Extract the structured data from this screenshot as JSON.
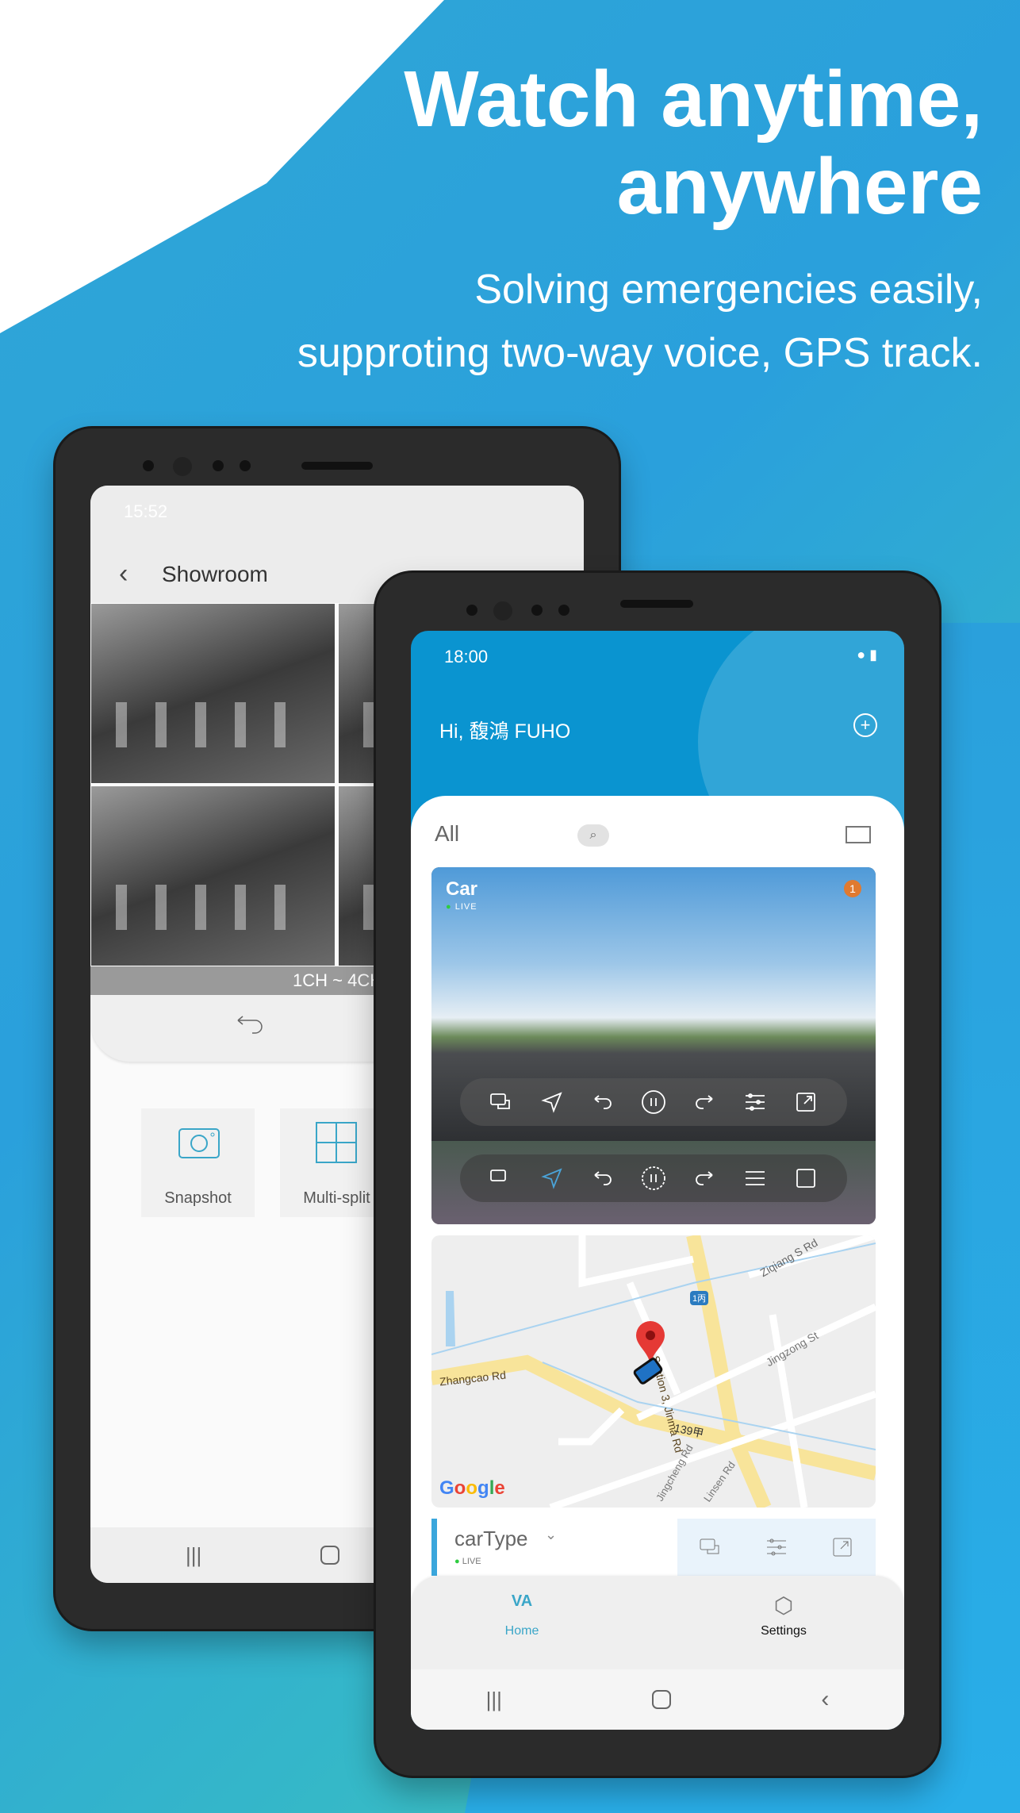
{
  "hero": {
    "title_line1": "Watch anytime,",
    "title_line2": "anywhere",
    "subtitle_line1": "Solving emergencies easily,",
    "subtitle_line2": "supproting two-way voice, GPS track."
  },
  "back_phone": {
    "status_time": "15:52",
    "title": "Showroom",
    "channel_label": "1CH ~ 4CH",
    "tiles": [
      {
        "label": "Snapshot",
        "icon": "camera-icon"
      },
      {
        "label": "Multi-split",
        "icon": "grid-icon"
      }
    ],
    "icon_color": "#3aa6c8"
  },
  "front_phone": {
    "status_time": "18:00",
    "greeting": "Hi,  馥鴻 FUHO",
    "filter_label": "All",
    "camera_card": {
      "name": "Car",
      "status": "LIVE",
      "badge": "1"
    },
    "map": {
      "labels": [
        "Zhangcao Rd",
        "Section 3, Jinma Rd",
        "Ziqiang S Rd",
        "Jingzong St",
        "139甲",
        "1丙",
        "Jingcheng Rd",
        "Linsen Rd"
      ],
      "logo": "Google"
    },
    "device_row": {
      "name": "carType",
      "status": "LIVE"
    },
    "tabs": [
      {
        "label": "Home",
        "active": true
      },
      {
        "label": "Settings",
        "active": false
      }
    ],
    "accent": "#0a94d0",
    "live_color": "#2ecc40",
    "badge_color": "#e07a30"
  }
}
